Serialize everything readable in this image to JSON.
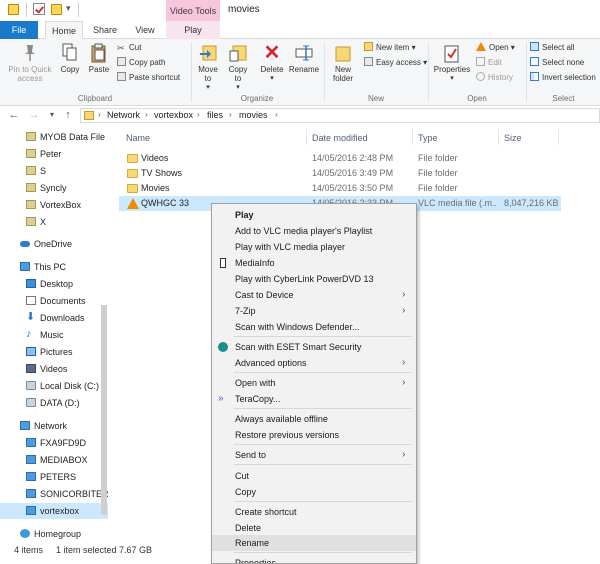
{
  "window": {
    "title": "movies",
    "context_tab": "Video Tools"
  },
  "tabs": {
    "file": "File",
    "home": "Home",
    "share": "Share",
    "view": "View",
    "play": "Play"
  },
  "ribbon": {
    "clipboard": {
      "label": "Clipboard",
      "pin": "Pin to Quick access",
      "copy": "Copy",
      "paste": "Paste",
      "cut": "Cut",
      "copy_path": "Copy path",
      "paste_shortcut": "Paste shortcut"
    },
    "organize": {
      "label": "Organize",
      "move_to": "Move to",
      "copy_to": "Copy to",
      "delete": "Delete",
      "rename": "Rename"
    },
    "new": {
      "label": "New",
      "new_folder": "New folder",
      "new_item": "New item",
      "easy_access": "Easy access"
    },
    "open": {
      "label": "Open",
      "properties": "Properties",
      "open": "Open",
      "edit": "Edit",
      "history": "History"
    },
    "select": {
      "label": "Select",
      "select_all": "Select all",
      "select_none": "Select none",
      "invert_selection": "Invert selection"
    }
  },
  "address": {
    "crumbs": [
      "Network",
      "vortexbox",
      "files",
      "movies"
    ]
  },
  "navpane": {
    "quick_access": [
      "MYOB Data File",
      "Peter",
      "S",
      "Syncly",
      "VortexBox",
      "X"
    ],
    "onedrive": "OneDrive",
    "this_pc": "This PC",
    "pc_items": [
      "Desktop",
      "Documents",
      "Downloads",
      "Music",
      "Pictures",
      "Videos",
      "Local Disk (C:)",
      "DATA (D:)"
    ],
    "network": "Network",
    "network_items": [
      "FXA9FD9D",
      "MEDIABOX",
      "PETERS",
      "SONICORBITER",
      "vortexbox"
    ],
    "homegroup": "Homegroup"
  },
  "columns": {
    "name": "Name",
    "date": "Date modified",
    "type": "Type",
    "size": "Size"
  },
  "files": [
    {
      "name": "Videos",
      "date": "14/05/2016 2:48 PM",
      "type": "File folder",
      "size": ""
    },
    {
      "name": "TV Shows",
      "date": "14/05/2016 3:49 PM",
      "type": "File folder",
      "size": ""
    },
    {
      "name": "Movies",
      "date": "14/05/2016 3:50 PM",
      "type": "File folder",
      "size": ""
    },
    {
      "name": "QWHGC 33",
      "date": "14/05/2016 2:33 PM",
      "type": "VLC media file (.m...",
      "size": "8,047,216 KB"
    }
  ],
  "status": {
    "count": "4 items",
    "selected": "1 item selected  7.67 GB"
  },
  "context_menu": {
    "play": "Play",
    "add_vlc_playlist": "Add to VLC media player's Playlist",
    "play_vlc": "Play with VLC media player",
    "mediainfo": "MediaInfo",
    "play_cyberlink": "Play with CyberLink PowerDVD 13",
    "cast": "Cast to Device",
    "zip": "7-Zip",
    "scan_defender": "Scan with Windows Defender...",
    "scan_eset": "Scan with ESET Smart Security",
    "advanced": "Advanced options",
    "open_with": "Open with",
    "teracopy": "TeraCopy...",
    "offline": "Always available offline",
    "restore": "Restore previous versions",
    "send_to": "Send to",
    "cut": "Cut",
    "copy": "Copy",
    "create_shortcut": "Create shortcut",
    "delete": "Delete",
    "rename": "Rename",
    "properties": "Properties"
  }
}
